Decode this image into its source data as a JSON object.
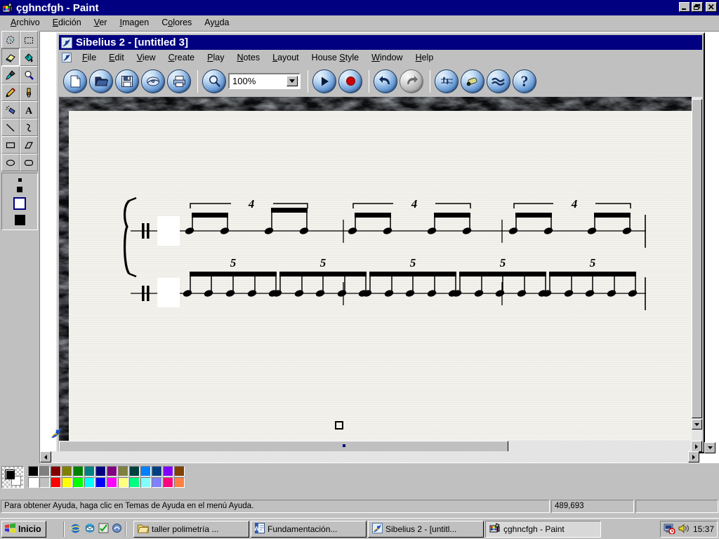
{
  "paint": {
    "title": "çghncfgh - Paint",
    "icon": "paint-icon",
    "menus": [
      {
        "label": "Archivo",
        "accel": "A"
      },
      {
        "label": "Edición",
        "accel": "E"
      },
      {
        "label": "Ver",
        "accel": "V"
      },
      {
        "label": "Imagen",
        "accel": "I"
      },
      {
        "label": "Colores",
        "accel": "o"
      },
      {
        "label": "Ayuda",
        "accel": "u"
      }
    ],
    "window_buttons": [
      {
        "name": "minimize-button",
        "glyph": "_"
      },
      {
        "name": "restore-button",
        "glyph": "❐"
      },
      {
        "name": "close-button",
        "glyph": "✕"
      }
    ],
    "tools": [
      {
        "name": "free-form-select-tool",
        "label": "Free-Form Select",
        "selected": false
      },
      {
        "name": "rectangle-select-tool",
        "label": "Select",
        "selected": false
      },
      {
        "name": "eraser-tool",
        "label": "Eraser",
        "selected": true
      },
      {
        "name": "fill-tool",
        "label": "Fill With Color",
        "selected": false
      },
      {
        "name": "pick-color-tool",
        "label": "Pick Color",
        "selected": false
      },
      {
        "name": "magnifier-tool",
        "label": "Magnifier",
        "selected": false
      },
      {
        "name": "pencil-tool",
        "label": "Pencil",
        "selected": false
      },
      {
        "name": "brush-tool",
        "label": "Brush",
        "selected": false
      },
      {
        "name": "airbrush-tool",
        "label": "Airbrush",
        "selected": false
      },
      {
        "name": "text-tool",
        "label": "Text",
        "selected": false
      },
      {
        "name": "line-tool",
        "label": "Line",
        "selected": false
      },
      {
        "name": "curve-tool",
        "label": "Curve",
        "selected": false
      },
      {
        "name": "rectangle-tool",
        "label": "Rectangle",
        "selected": false
      },
      {
        "name": "polygon-tool",
        "label": "Polygon",
        "selected": false
      },
      {
        "name": "ellipse-tool",
        "label": "Ellipse",
        "selected": false
      },
      {
        "name": "rounded-rectangle-tool",
        "label": "Rounded Rectangle",
        "selected": false
      }
    ],
    "eraser_sizes": [
      5,
      8,
      14,
      20
    ],
    "eraser_selected_index": 2,
    "palette": {
      "foreground": "#000000",
      "background": "#ffffff",
      "row1": [
        "#000000",
        "#808080",
        "#800000",
        "#808000",
        "#008000",
        "#008080",
        "#000080",
        "#800080",
        "#808040",
        "#004040",
        "#0080ff",
        "#004080",
        "#8000ff",
        "#804000"
      ],
      "row2": [
        "#ffffff",
        "#c0c0c0",
        "#ff0000",
        "#ffff00",
        "#00ff00",
        "#00ffff",
        "#0000ff",
        "#ff00ff",
        "#ffff80",
        "#00ff80",
        "#80ffff",
        "#8080ff",
        "#ff0080",
        "#ff8040"
      ]
    },
    "status": {
      "help_text": "Para obtener Ayuda, haga clic en Temas de Ayuda en el menú Ayuda.",
      "size_text": "489,693",
      "extra_text": ""
    }
  },
  "sibelius": {
    "title": "Sibelius 2 - [untitled 3]",
    "icon": "sibelius-icon",
    "menus": [
      {
        "label": "File",
        "accel": "F"
      },
      {
        "label": "Edit",
        "accel": "E"
      },
      {
        "label": "View",
        "accel": "V"
      },
      {
        "label": "Create",
        "accel": "C"
      },
      {
        "label": "Play",
        "accel": "P"
      },
      {
        "label": "Notes",
        "accel": "N"
      },
      {
        "label": "Layout",
        "accel": "L"
      },
      {
        "label": "House Style",
        "accel": "S"
      },
      {
        "label": "Window",
        "accel": "W"
      },
      {
        "label": "Help",
        "accel": "H"
      }
    ],
    "toolbar": [
      {
        "name": "new-score-button",
        "icon": "page-icon",
        "group": 1
      },
      {
        "name": "open-score-button",
        "icon": "folder-icon",
        "group": 1
      },
      {
        "name": "save-score-button",
        "icon": "floppy-disk-icon",
        "group": 1
      },
      {
        "name": "export-graphic-button",
        "icon": "disc-icon",
        "group": 1
      },
      {
        "name": "print-button",
        "icon": "printer-icon",
        "group": 1
      },
      {
        "name": "zoom-button",
        "icon": "magnifier-icon",
        "group": 2
      },
      {
        "name": "play-button",
        "icon": "play-triangle-icon",
        "group": 3
      },
      {
        "name": "record-flexitime-button",
        "icon": "record-circle-icon",
        "group": 3
      },
      {
        "name": "undo-button",
        "icon": "undo-arrow-icon",
        "group": 4
      },
      {
        "name": "redo-button",
        "icon": "redo-arrow-icon",
        "group": 4,
        "disabled": true
      },
      {
        "name": "keypad-button",
        "icon": "keypad-icon",
        "group": 5
      },
      {
        "name": "kaleidoscope-button",
        "icon": "kaleidoscope-icon",
        "group": 5
      },
      {
        "name": "navigator-button",
        "icon": "navigator-waves-icon",
        "group": 5
      },
      {
        "name": "help-button",
        "icon": "question-mark-icon",
        "group": 5
      }
    ],
    "zoom": {
      "value": "100%",
      "label": "Zoom level"
    }
  },
  "score": {
    "staves": [
      {
        "id": "upper-staff",
        "clef": "percussion-clef",
        "tuplet_number": "4",
        "groups": 3,
        "notes_per_beam": 2,
        "beams_per_tuplet": 2,
        "barlines": 3
      },
      {
        "id": "lower-staff",
        "clef": "percussion-clef",
        "tuplet_number": "5",
        "groups": 5,
        "notes_per_beam": 5,
        "beams_per_tuplet": 1,
        "barlines": 3
      }
    ],
    "brace": "system-brace",
    "selection_handle": "square-handle"
  },
  "taskbar": {
    "start_label": "Inicio",
    "quick_launch": [
      {
        "name": "internet-explorer-icon"
      },
      {
        "name": "outlook-express-icon"
      },
      {
        "name": "show-desktop-icon"
      },
      {
        "name": "channels-icon"
      }
    ],
    "tasks": [
      {
        "name": "task-taller-polimetria",
        "label": "taller polimetría ...",
        "icon": "folder-icon",
        "active": false
      },
      {
        "name": "task-fundamentacion",
        "label": "Fundamentación...",
        "icon": "word-icon",
        "active": false
      },
      {
        "name": "task-sibelius",
        "label": "Sibelius 2 - [untitl...",
        "icon": "sibelius-icon",
        "active": false
      },
      {
        "name": "task-paint",
        "label": "çghncfgh - Paint",
        "icon": "paint-icon",
        "active": true
      }
    ],
    "tray": [
      {
        "name": "scheduler-icon"
      },
      {
        "name": "volume-icon"
      }
    ],
    "clock": "15:37"
  },
  "colors": {
    "titlebar_active": "#000080",
    "face": "#c0c0c0",
    "score_paper": "#f4f2ed",
    "marble": "#0b0c0e",
    "record_red": "#cc0000"
  }
}
